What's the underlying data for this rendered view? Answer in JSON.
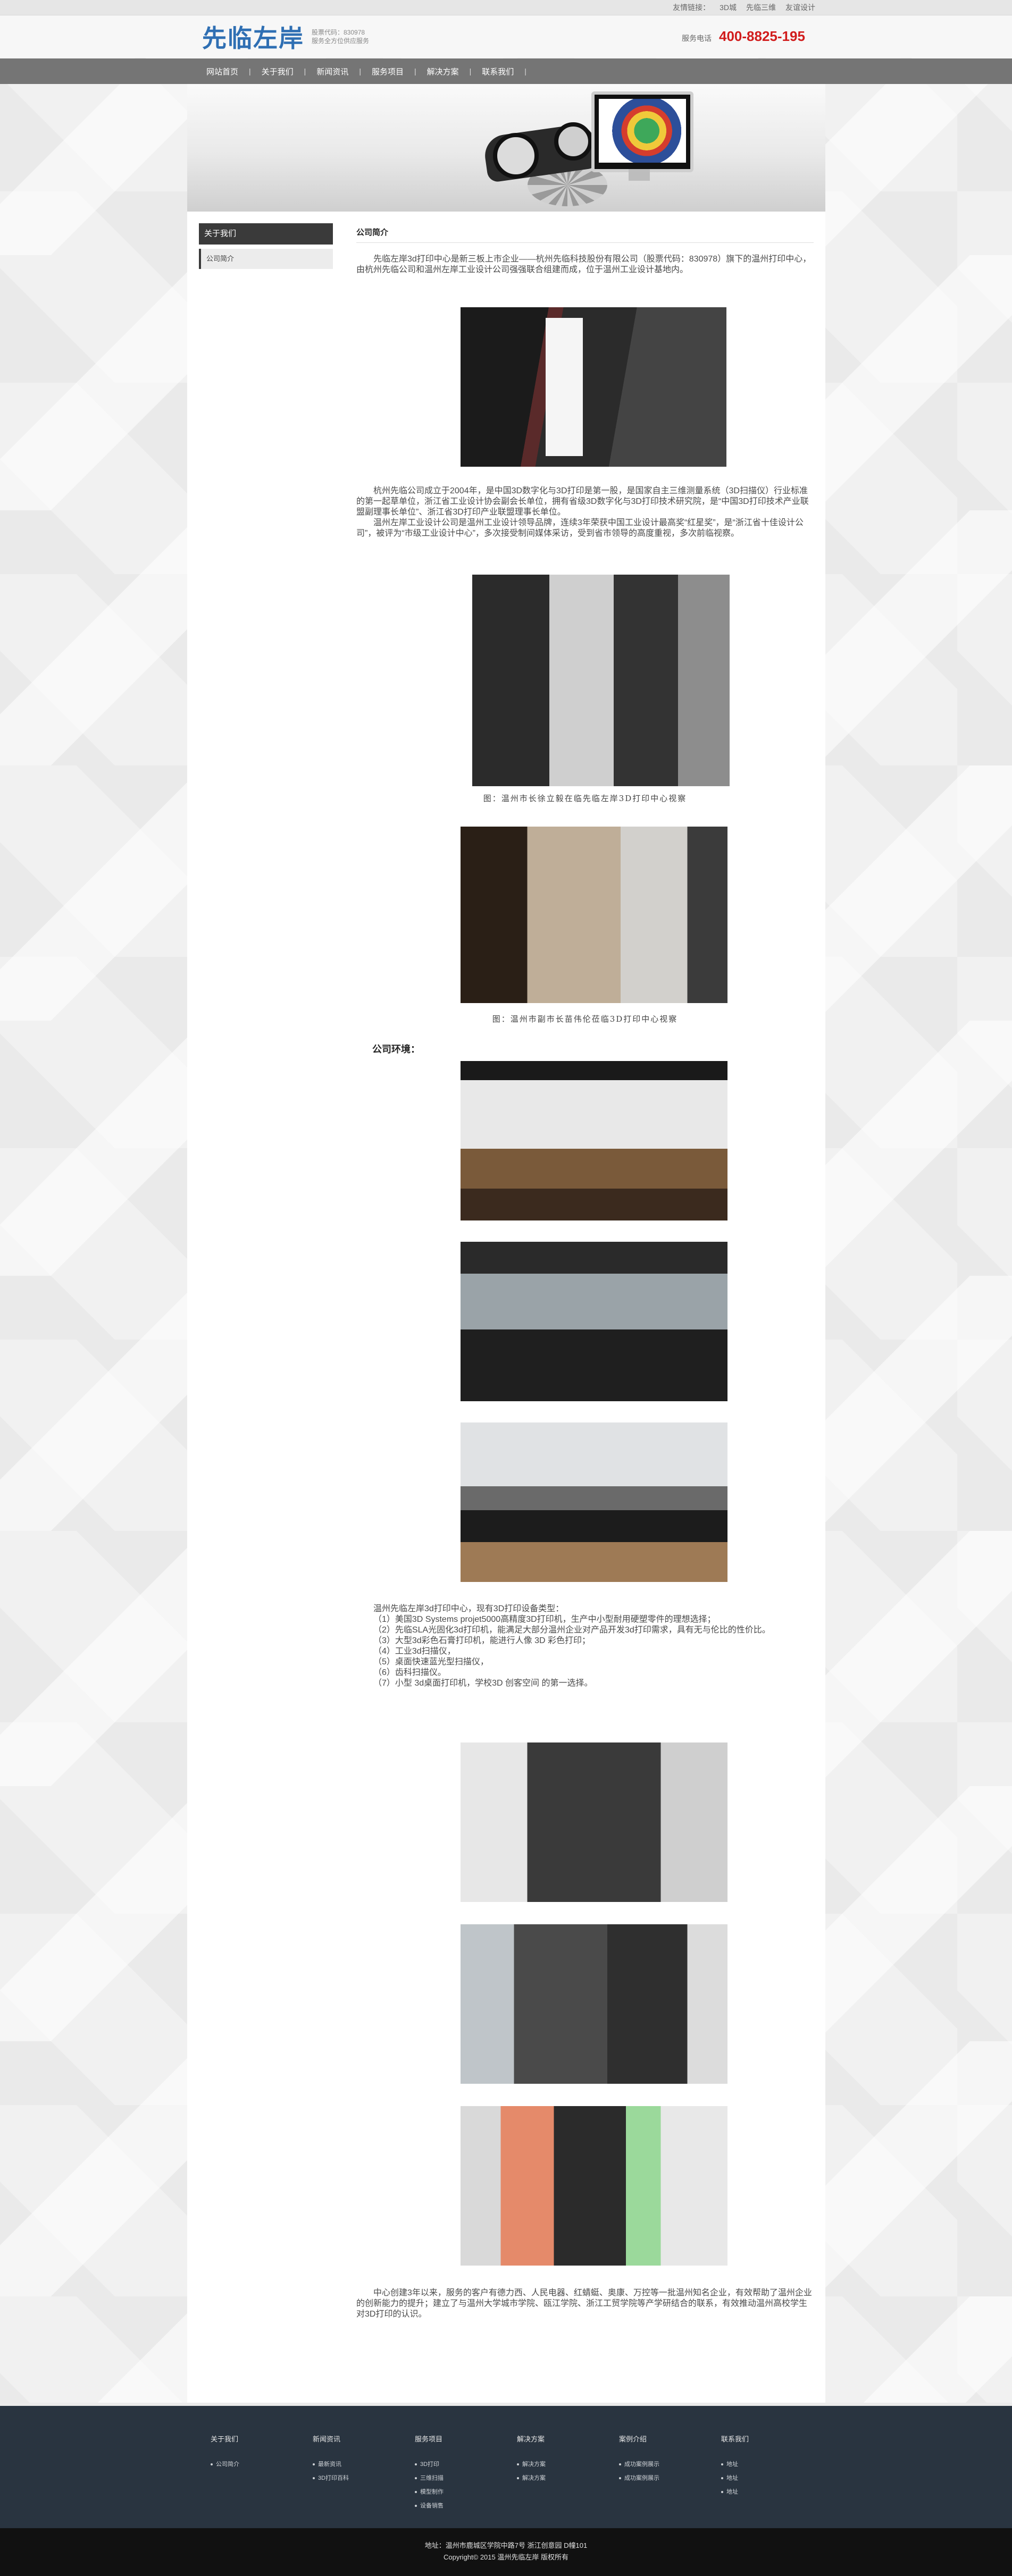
{
  "topbar": {
    "links": [
      "友情链接：",
      "3D城",
      "先临三维",
      "友谊设计"
    ]
  },
  "header": {
    "logo_text": "先临左岸",
    "logo_sub_line1": "股票代码：830978",
    "logo_sub_line2": "服务全方位供应服务",
    "hotline_label": "服务电话",
    "hotline_number": "400-8825-195"
  },
  "nav": {
    "items": [
      "网站首页",
      "关于我们",
      "新闻资讯",
      "服务项目",
      "解决方案",
      "联系我们"
    ]
  },
  "sidebar": {
    "title": "关于我们",
    "items": [
      "公司简介"
    ]
  },
  "main": {
    "title": "公司简介",
    "intro": "先临左岸3d打印中心是新三板上市企业——杭州先临科技股份有限公司（股票代码：830978）旗下的温州打印中心，由杭州先临公司和温州左岸工业设计公司强强联合组建而成，位于温州工业设计基地内。",
    "history_1": "杭州先临公司成立于2004年，是中国3D数字化与3D打印是第一股，是国家自主三维测量系统（3D扫描仪）行业标准的第一起草单位，浙江省工业设计协会副会长单位，拥有省级3D数字化与3D打印技术研究院，是“中国3D打印技术产业联盟副理事长单位”、浙江省3D打印产业联盟理事长单位。",
    "history_2": "温州左岸工业设计公司是温州工业设计领导品牌，连续3年荣获中国工业设计最高奖“红星奖”，是“浙江省十佳设计公司”，被评为“市级工业设计中心”，多次接受制间媒体采访，受到省市领导的高度重视，多次前临视察。",
    "caption_1": "图：温州市长徐立毅在临先临左岸3D打印中心视察",
    "caption_2": "图：温州市副市长苗伟伦莅临3D打印中心视察",
    "env_label": "公司环境：",
    "equipment_intro": "温州先临左岸3d打印中心，现有3D打印设备类型：",
    "equipment": [
      "（1）美国3D Systems projet5000高精度3D打印机，生产中小型耐用硬塑零件的理想选择；",
      "（2）先临SLA光固化3d打印机，能满足大部分温州企业对产品开发3d打印需求，具有无与伦比的性价比。",
      "（3）大型3d彩色石膏打印机，能进行人像 3D 彩色打印；",
      "（4）工业3d扫描仪，",
      "（5）桌面快速蓝光型扫描仪，",
      "（6）齿科扫描仪。",
      "（7）小型 3d桌面打印机，学校3D 创客空间 的第一选择。"
    ],
    "closing": "中心创建3年以来，服务的客户有德力西、人民电器、红蜻蜓、奥康、万控等一批温州知名企业，有效帮助了温州企业的创新能力的提升；建立了与温州大学城市学院、瓯江学院、浙江工贸学院等产学研结合的联系，有效推动温州高校学生对3D打印的认识。"
  },
  "footer": {
    "columns": [
      {
        "title": "关于我们",
        "items": [
          "公司简介"
        ]
      },
      {
        "title": "新闻资讯",
        "items": [
          "最新资讯",
          "3D打印百科"
        ]
      },
      {
        "title": "服务项目",
        "items": [
          "3D打印",
          "三维扫描",
          "模型制作",
          "设备销售"
        ]
      },
      {
        "title": "解决方案",
        "items": [
          "解决方案",
          "解决方案"
        ]
      },
      {
        "title": "案例介绍",
        "items": [
          "成功案例展示",
          "成功案例展示"
        ]
      },
      {
        "title": "联系我们",
        "items": [
          "地址",
          "地址",
          "地址"
        ]
      }
    ],
    "address": "地址：温州市鹿城区学院中路7号 浙江创意园 D幢101",
    "copyright": "Copyright© 2015 温州先临左岸 版权所有"
  }
}
